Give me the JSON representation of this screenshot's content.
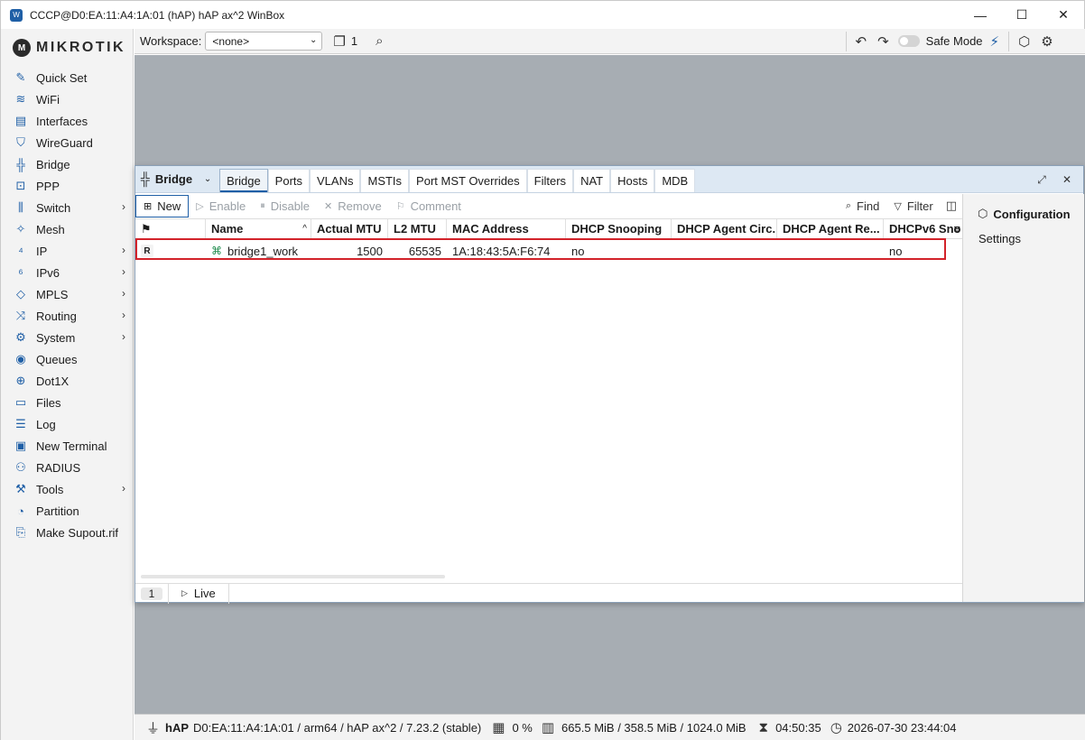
{
  "window": {
    "title": "CCCP@D0:EA:11:A4:1A:01 (hAP) hAP ax^2 WinBox",
    "minimize": "—",
    "maximize": "☐",
    "close": "✕"
  },
  "logo": {
    "text": "MIKROTIK"
  },
  "sidebar": {
    "items": [
      {
        "label": "Quick Set",
        "icon": "magic-wand-icon",
        "glyph": "✎",
        "chevron": false
      },
      {
        "label": "WiFi",
        "icon": "wifi-icon",
        "glyph": "≋",
        "chevron": false
      },
      {
        "label": "Interfaces",
        "icon": "interfaces-icon",
        "glyph": "▤",
        "chevron": false
      },
      {
        "label": "WireGuard",
        "icon": "shield-icon",
        "glyph": "⛉",
        "chevron": false
      },
      {
        "label": "Bridge",
        "icon": "bridge-icon",
        "glyph": "╬",
        "chevron": false
      },
      {
        "label": "PPP",
        "icon": "ppp-icon",
        "glyph": "⊡",
        "chevron": false
      },
      {
        "label": "Switch",
        "icon": "switch-icon",
        "glyph": "⫼",
        "chevron": true
      },
      {
        "label": "Mesh",
        "icon": "mesh-icon",
        "glyph": "✧",
        "chevron": false
      },
      {
        "label": "IP",
        "icon": "ip-icon",
        "glyph": "⁴",
        "chevron": true
      },
      {
        "label": "IPv6",
        "icon": "ipv6-icon",
        "glyph": "⁶",
        "chevron": true
      },
      {
        "label": "MPLS",
        "icon": "tag-icon",
        "glyph": "◇",
        "chevron": true
      },
      {
        "label": "Routing",
        "icon": "routing-icon",
        "glyph": "⤨",
        "chevron": true
      },
      {
        "label": "System",
        "icon": "gear-icon",
        "glyph": "⚙",
        "chevron": true
      },
      {
        "label": "Queues",
        "icon": "queues-icon",
        "glyph": "◉",
        "chevron": false
      },
      {
        "label": "Dot1X",
        "icon": "dot1x-icon",
        "glyph": "⊕",
        "chevron": false
      },
      {
        "label": "Files",
        "icon": "folder-icon",
        "glyph": "▭",
        "chevron": false
      },
      {
        "label": "Log",
        "icon": "log-icon",
        "glyph": "☰",
        "chevron": false
      },
      {
        "label": "New Terminal",
        "icon": "terminal-icon",
        "glyph": "▣",
        "chevron": false
      },
      {
        "label": "RADIUS",
        "icon": "radius-icon",
        "glyph": "⚇",
        "chevron": false
      },
      {
        "label": "Tools",
        "icon": "tools-icon",
        "glyph": "⚒",
        "chevron": true
      },
      {
        "label": "Partition",
        "icon": "partition-icon",
        "glyph": "◔",
        "chevron": false
      },
      {
        "label": "Make Supout.rif",
        "icon": "supout-icon",
        "glyph": "⎘",
        "chevron": false
      }
    ]
  },
  "toolbar": {
    "workspace_label": "Workspace:",
    "workspace_value": "<none>",
    "window_count": "1",
    "safe_mode_label": "Safe Mode"
  },
  "bridge_window": {
    "title": "Bridge",
    "tabs": [
      "Bridge",
      "Ports",
      "VLANs",
      "MSTIs",
      "Port MST Overrides",
      "Filters",
      "NAT",
      "Hosts",
      "MDB"
    ],
    "active_tab": 0,
    "actions": {
      "new": "New",
      "enable": "Enable",
      "disable": "Disable",
      "remove": "Remove",
      "comment": "Comment",
      "find": "Find",
      "filter": "Filter"
    },
    "columns": [
      "Name",
      "Actual MTU",
      "L2 MTU",
      "MAC Address",
      "DHCP Snooping",
      "DHCP Agent Circ...",
      "DHCP Agent Re...",
      "DHCPv6 Sno"
    ],
    "rows": [
      {
        "flag": "R",
        "name": "bridge1_work",
        "actual_mtu": "1500",
        "l2_mtu": "65535",
        "mac": "1A:18:43:5A:F6:74",
        "dhcp_snooping": "no",
        "agent_circuit": "",
        "agent_remote": "",
        "dhcpv6": "no"
      }
    ],
    "footer": {
      "count": "1",
      "live": "Live"
    },
    "panel": {
      "title": "Configuration",
      "item": "Settings"
    }
  },
  "status": {
    "model": "hAP",
    "info": "D0:EA:11:A4:1A:01 / arm64 / hAP ax^2 / 7.23.2 (stable)",
    "cpu": "0 %",
    "memory": "665.5 MiB / 358.5 MiB / 1024.0 MiB",
    "uptime": "04:50:35",
    "datetime": "2026-07-30 23:44:04"
  }
}
